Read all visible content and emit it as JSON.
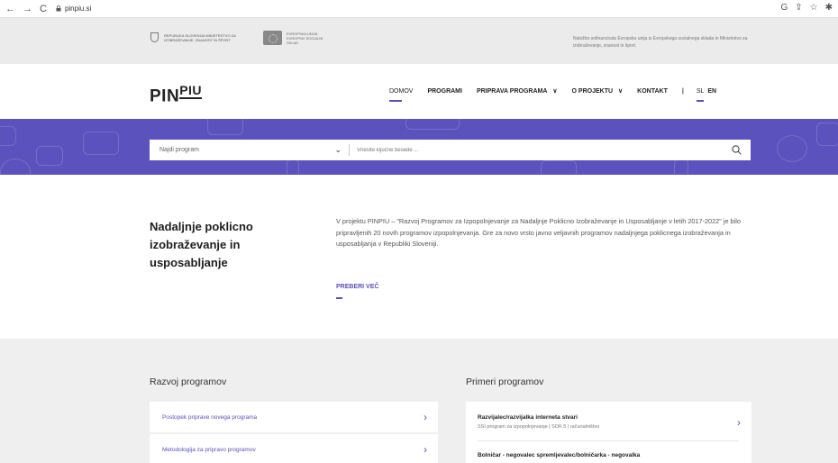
{
  "browser": {
    "url": "pinpiu.si",
    "back_glyph": "←",
    "forward_glyph": "→",
    "reload_glyph": "C"
  },
  "funding": {
    "ministry_name": "Republika Slovenija Ministrstvo za izobraževanje, znanost in šport",
    "eu_name": "Evropska unija Evropski socialni sklad",
    "note": "Naložbo sofinancirata Evropska unija iz Evropskega socialnega sklada in Ministrstvo za izobraževanje, znanost in šport."
  },
  "header": {
    "logo_pin": "PIN",
    "logo_piu": "PIU",
    "nav": {
      "domov": "DOMOV",
      "programi": "PROGRAMI",
      "priprava": "PRIPRAVA PROGRAMA",
      "projekt": "O PROJEKTU",
      "kontakt": "KONTAKT",
      "separator": "|",
      "lang_sl": "SL",
      "lang_en": "EN"
    }
  },
  "search": {
    "select_label": "Najdi program",
    "input_placeholder": "Vnesite ključne besede ..."
  },
  "intro": {
    "title": "Nadaljnje poklicno izobraževanje in usposabljanje",
    "text": "V projektu PINPIU – \"Razvoj Programov za Izpopolnjevanje za Nadaljnje Poklicno Izobraževanje in Usposabljanje v letih 2017-2022\" je bilo pripravljenih 20 novih programov izpopolnjevanja. Gre za novo vrsto javno veljavnih programov nadaljnjega poklicnega izobraževanja in usposabljanja v Republiki Sloveniji.",
    "read_more": "PREBERI VEČ"
  },
  "development": {
    "title": "Razvoj programov",
    "items": [
      {
        "label": "Postopek priprave novega programa"
      },
      {
        "label": "Metodologija za pripravo programov"
      }
    ]
  },
  "examples": {
    "title": "Primeri programov",
    "items": [
      {
        "title": "Razvijalec/razvijalka interneta stvari",
        "meta": "SSI program za izpopolnjevanje  |  SOK 5  |  računalništvo"
      },
      {
        "title": "Bolničar - negovalec spremljevalec/bolničarka - negovalka",
        "meta": ""
      }
    ]
  },
  "colors": {
    "accent": "#5b50b8",
    "band": "#5b52bd",
    "funding_bg": "#ebebeb",
    "lower_bg": "#efefef"
  }
}
